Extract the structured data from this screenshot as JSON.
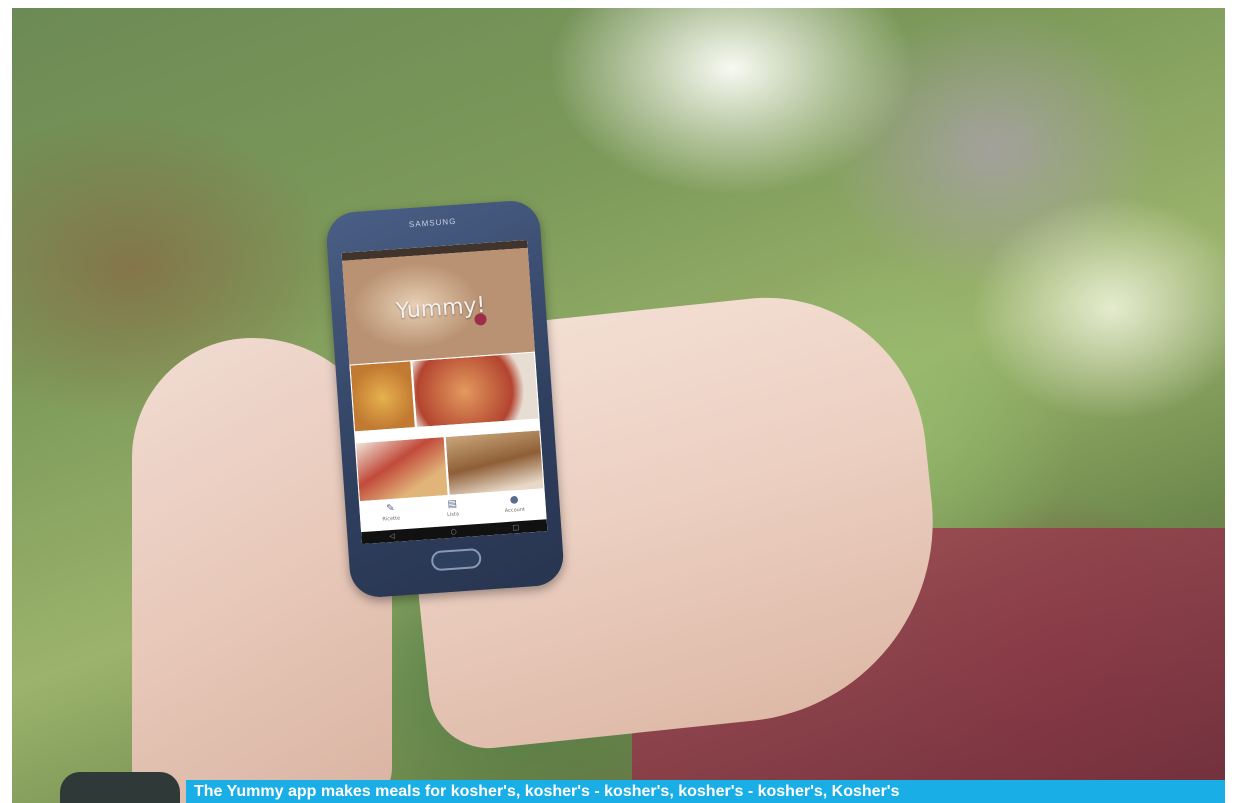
{
  "phone": {
    "brand": "SAMSUNG"
  },
  "app": {
    "hero_title": "Yummy!",
    "nav_items": [
      {
        "icon_name": "recipes-icon",
        "icon": "✎",
        "label": "Ricette"
      },
      {
        "icon_name": "list-icon",
        "icon": "▤",
        "label": "Lista"
      },
      {
        "icon_name": "account-icon",
        "icon": "●",
        "label": "Account"
      }
    ],
    "system_nav": {
      "back": "◁",
      "home": "○",
      "recent": "□"
    }
  },
  "caption": {
    "text": "The Yummy app makes meals for kosher's, kosher's - kosher's, kosher's - kosher's, Kosher's"
  },
  "colors": {
    "caption_bar": "#1aaee6",
    "phone_body": "#2f3f5e"
  }
}
